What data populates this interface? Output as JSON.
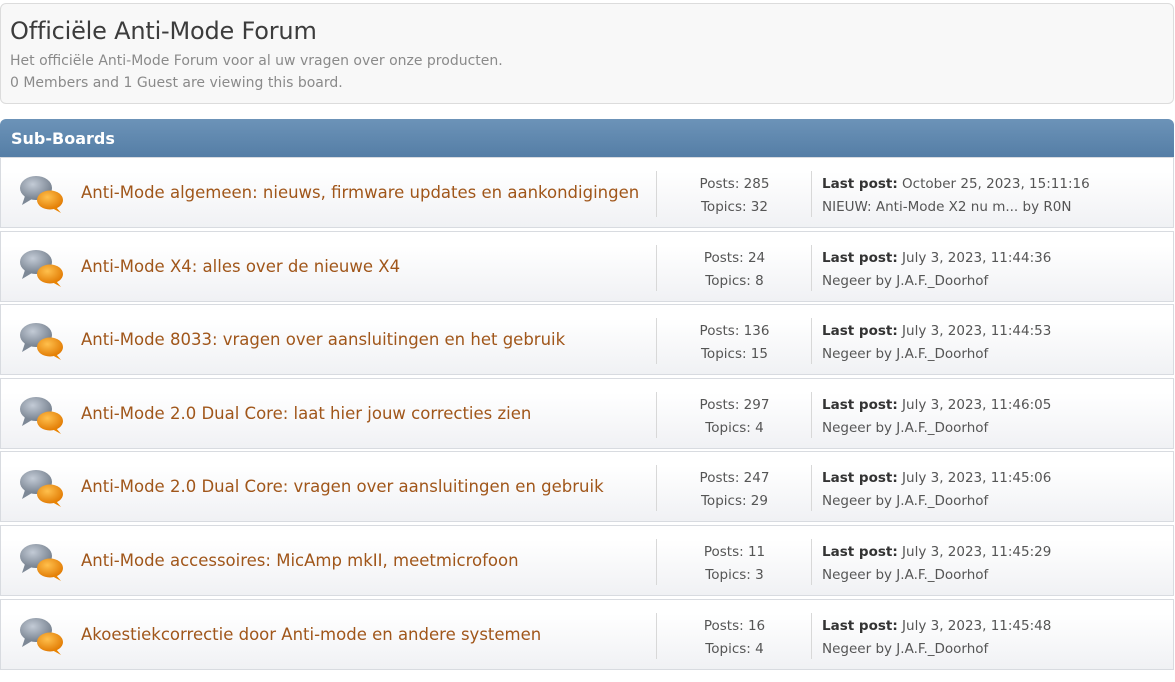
{
  "board": {
    "title": "Officiële Anti-Mode Forum",
    "description": "Het officiële Anti-Mode Forum voor al uw vragen over onze producten.",
    "viewers": "0 Members and 1 Guest are viewing this board."
  },
  "subboards": {
    "heading": "Sub-Boards",
    "icon": "speech-bubbles-icon",
    "colors": {
      "bar": "#5f88b0",
      "title": "#a0561a",
      "bubble_grey": "#8a94a2",
      "bubble_orange": "#f08c00"
    },
    "rows": [
      {
        "title": "Anti-Mode algemeen: nieuws, firmware updates en aankondigingen",
        "posts": "Posts: 285",
        "topics": "Topics: 32",
        "last_label": "Last post:",
        "last_date": "October 25, 2023, 15:11:16",
        "last_topic": "NIEUW: Anti-Mode X2 nu m...",
        "by": "by",
        "author": "R0N"
      },
      {
        "title": "Anti-Mode X4: alles over de nieuwe X4",
        "posts": "Posts: 24",
        "topics": "Topics: 8",
        "last_label": "Last post:",
        "last_date": "July 3, 2023, 11:44:36",
        "last_topic": "Negeer",
        "by": "by",
        "author": "J.A.F._Doorhof"
      },
      {
        "title": "Anti-Mode 8033: vragen over aansluitingen en het gebruik",
        "posts": "Posts: 136",
        "topics": "Topics: 15",
        "last_label": "Last post:",
        "last_date": "July 3, 2023, 11:44:53",
        "last_topic": "Negeer",
        "by": "by",
        "author": "J.A.F._Doorhof"
      },
      {
        "title": "Anti-Mode 2.0 Dual Core: laat hier jouw correcties zien",
        "posts": "Posts: 297",
        "topics": "Topics: 4",
        "last_label": "Last post:",
        "last_date": "July 3, 2023, 11:46:05",
        "last_topic": "Negeer",
        "by": "by",
        "author": "J.A.F._Doorhof"
      },
      {
        "title": "Anti-Mode 2.0 Dual Core: vragen over aansluitingen en gebruik",
        "posts": "Posts: 247",
        "topics": "Topics: 29",
        "last_label": "Last post:",
        "last_date": "July 3, 2023, 11:45:06",
        "last_topic": "Negeer",
        "by": "by",
        "author": "J.A.F._Doorhof"
      },
      {
        "title": "Anti-Mode accessoires: MicAmp mkII, meetmicrofoon",
        "posts": "Posts: 11",
        "topics": "Topics: 3",
        "last_label": "Last post:",
        "last_date": "July 3, 2023, 11:45:29",
        "last_topic": "Negeer",
        "by": "by",
        "author": "J.A.F._Doorhof"
      },
      {
        "title": "Akoestiekcorrectie door Anti-mode en andere systemen",
        "posts": "Posts: 16",
        "topics": "Topics: 4",
        "last_label": "Last post:",
        "last_date": "July 3, 2023, 11:45:48",
        "last_topic": "Negeer",
        "by": "by",
        "author": "J.A.F._Doorhof"
      }
    ]
  }
}
